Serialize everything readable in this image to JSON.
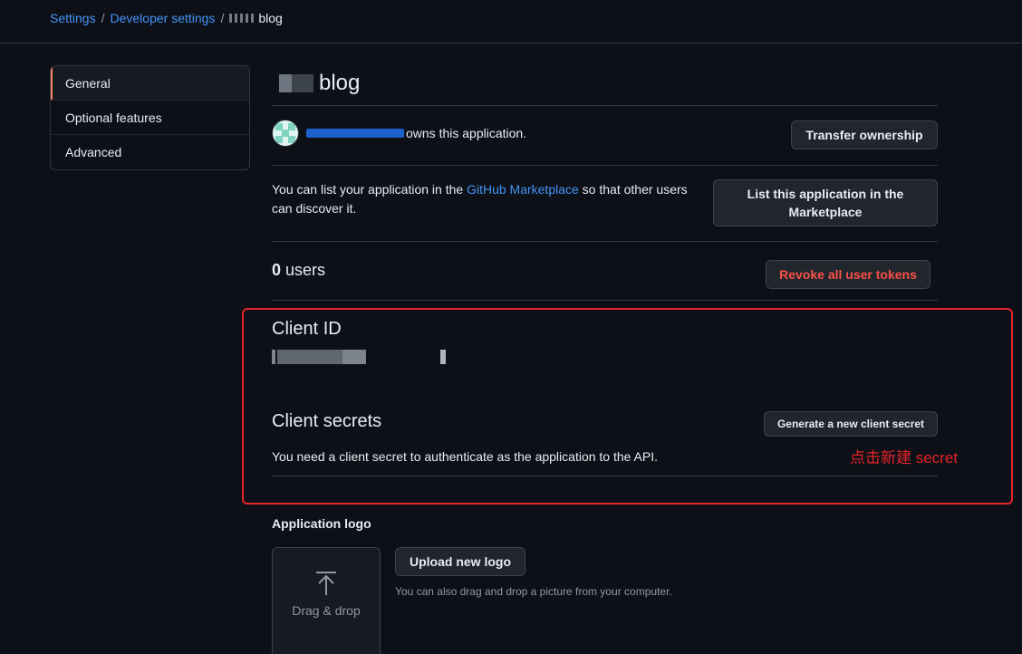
{
  "breadcrumb": {
    "settings": "Settings",
    "separator": "/",
    "developer_settings": "Developer settings",
    "current": "blog"
  },
  "sidebar": {
    "items": [
      {
        "label": "General"
      },
      {
        "label": "Optional features"
      },
      {
        "label": "Advanced"
      }
    ]
  },
  "app": {
    "title": "blog",
    "owner_text": "owns this application.",
    "transfer_button": "Transfer ownership",
    "marketplace_text_before": "You can list your application in the ",
    "marketplace_link": "GitHub Marketplace",
    "marketplace_text_after": " so that other users can discover it.",
    "marketplace_button": "List this application in the Marketplace",
    "users_count": "0",
    "users_label": "users",
    "revoke_button": "Revoke all user tokens"
  },
  "client": {
    "client_id_heading": "Client ID",
    "client_secrets_heading": "Client secrets",
    "generate_button": "Generate a new client secret",
    "secret_description": "You need a client secret to authenticate as the application to the API.",
    "annotation": "点击新建 secret"
  },
  "logo": {
    "heading": "Application logo",
    "drag_drop": "Drag & drop",
    "upload_button": "Upload new logo",
    "upload_hint": "You can also drag and drop a picture from your computer."
  },
  "colors": {
    "background": "#0d1117",
    "link": "#4493f8",
    "danger": "#f85149",
    "annotation": "#e5232a",
    "selected_indicator": "#f78166"
  }
}
